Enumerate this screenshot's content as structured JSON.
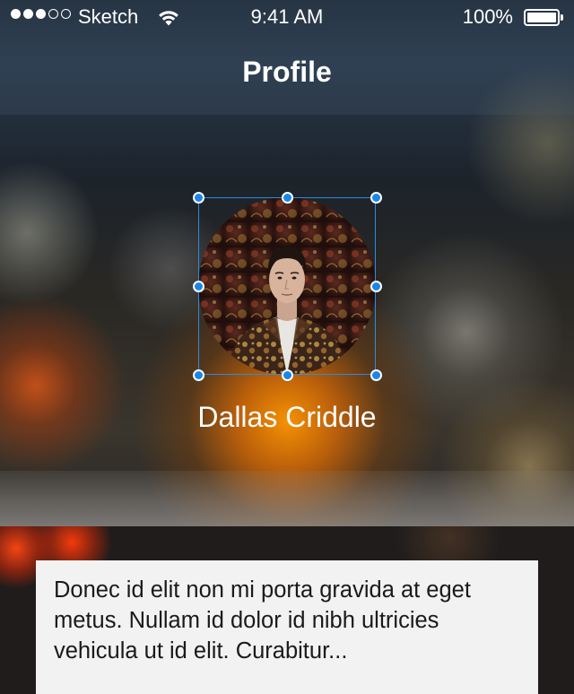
{
  "status_bar": {
    "signal_dots": [
      "full",
      "full",
      "full",
      "empty",
      "empty"
    ],
    "carrier": "Sketch",
    "wifi_icon": "wifi-icon",
    "time": "9:41 AM",
    "battery_percent": "100%",
    "battery_level": 1.0,
    "battery_icon": "battery-icon"
  },
  "nav": {
    "title": "Profile"
  },
  "profile": {
    "name": "Dallas Criddle",
    "avatar_icon": "avatar-photo",
    "selection_color": "#1a86e8"
  },
  "bio": {
    "text": "Donec id elit non mi porta gravida at eget metus. Nullam id dolor id nibh ultricies vehicula ut id elit. Curabitur..."
  },
  "colors": {
    "accent_glow": "#ff9600",
    "card_background": "#f2f2f2",
    "text_dark": "#1a1a1a"
  }
}
